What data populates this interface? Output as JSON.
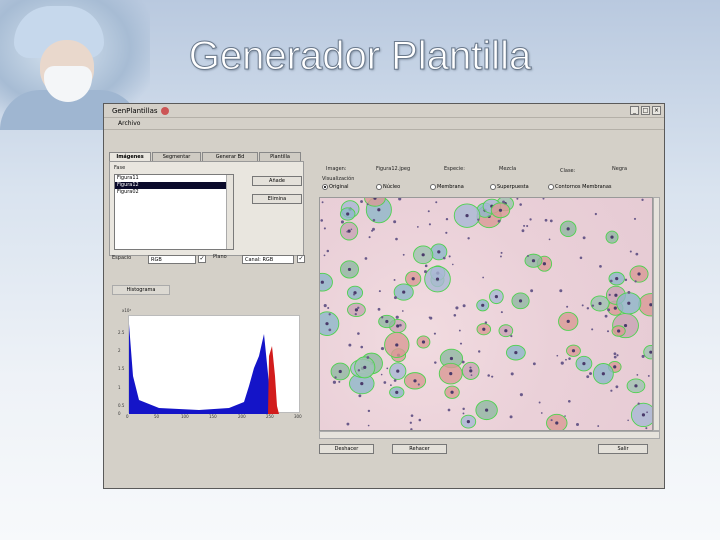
{
  "slide": {
    "title": "Generador Plantilla"
  },
  "window": {
    "title": "GenPlantillas",
    "controls": [
      "_",
      "□",
      "×"
    ],
    "menu": "Archivo"
  },
  "tabs": [
    {
      "label": "Imágenes",
      "active": true
    },
    {
      "label": "Segmentar",
      "active": false
    },
    {
      "label": "Generar Bd",
      "active": false
    },
    {
      "label": "Plantilla",
      "active": false
    }
  ],
  "left": {
    "group_label": "Fase",
    "images": [
      "Figura11",
      "Figura12",
      "Figura02"
    ],
    "selected_index": 1,
    "add_button": "Añade",
    "delete_button": "Elimina",
    "space_label": "Espacio",
    "space_value": "RGB",
    "plane_label": "Plano",
    "plane_value": "Canal: RGB",
    "histogram_label": "Histograma",
    "hist_exponent": "x10⁴",
    "y_ticks": [
      "2.5",
      "2",
      "1.5",
      "1",
      "0.5",
      "0"
    ],
    "x_ticks": [
      "0",
      "50",
      "100",
      "150",
      "200",
      "250",
      "300"
    ]
  },
  "right": {
    "image_label": "Imagen:",
    "image_value": "Figura12.jpeg",
    "species_label": "Especie:",
    "species_value": "Mezcla",
    "class_label": "Clase:",
    "class_value": "Negra",
    "view_label": "Visualización",
    "radios": [
      {
        "label": "Original",
        "on": true
      },
      {
        "label": "Núcleo",
        "on": false
      },
      {
        "label": "Membrana",
        "on": false
      },
      {
        "label": "Superpuesta",
        "on": false
      },
      {
        "label": "Contornos Membranas",
        "on": false
      }
    ],
    "prev_button": "Deshacer",
    "redo_button": "Rehacer",
    "exit_button": "Salir"
  },
  "colors": {
    "hist_blue": "#1414c8",
    "hist_red": "#d21c1c",
    "cell_border": "#4fd24f"
  }
}
